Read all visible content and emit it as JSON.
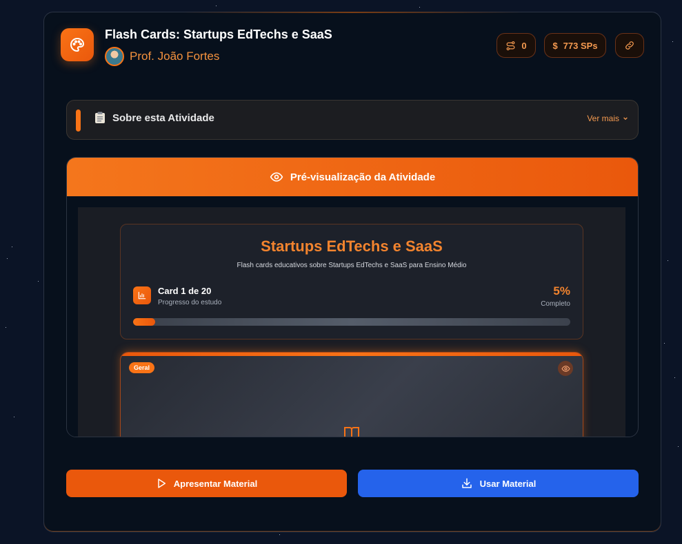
{
  "header": {
    "title": "Flash Cards: Startups EdTechs e SaaS",
    "author": "Prof. João Fortes",
    "stats": {
      "connections_count": "0",
      "currency_symbol": "$",
      "sps": "773 SPs"
    }
  },
  "about": {
    "label": "Sobre esta Atividade",
    "more": "Ver mais"
  },
  "preview": {
    "header_label": "Pré-visualização da Atividade",
    "deck_title": "Startups EdTechs e SaaS",
    "deck_subtitle": "Flash cards educativos sobre Startups EdTechs e SaaS para Ensino Médio",
    "card_counter": "Card 1 de 20",
    "progress_label": "Progresso do estudo",
    "percent": "5%",
    "percent_caption": "Completo",
    "progress_value": 0.05,
    "card_tag": "Geral"
  },
  "actions": {
    "present": "Apresentar Material",
    "use": "Usar Material"
  },
  "colors": {
    "accent": "#f97316",
    "primary_blue": "#2563eb"
  }
}
